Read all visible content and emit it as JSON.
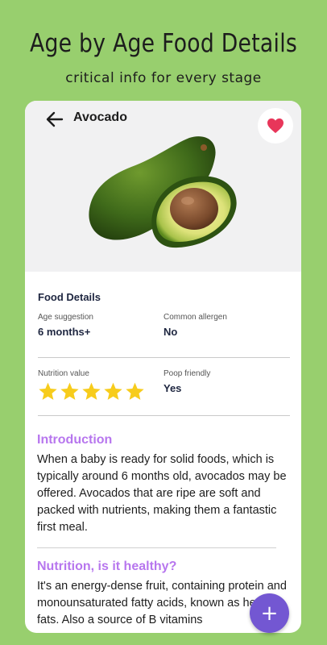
{
  "promo": {
    "headline": "Age by Age Food Details",
    "subheadline": "critical info for every stage"
  },
  "header": {
    "title": "Avocado",
    "back_icon": "arrow-left-icon",
    "favorite_icon": "heart-icon"
  },
  "details": {
    "section_title": "Food Details",
    "age_label": "Age suggestion",
    "age_value": "6 months+",
    "allergen_label": "Common allergen",
    "allergen_value": "No",
    "nutrition_label": "Nutrition value",
    "nutrition_rating": 5,
    "nutrition_max": 5,
    "poop_label": "Poop friendly",
    "poop_value": "Yes"
  },
  "article": {
    "intro_heading": "Introduction",
    "intro_body": "When a baby is ready for solid foods, which is typically around 6 months old, avocados may be offered. Avocados that are ripe are soft and packed with nutrients, making them a fantastic first meal.",
    "nutrition_heading": "Nutrition, is it healthy?",
    "nutrition_body": "It's an energy-dense fruit, containing protein and monounsaturated fatty acids, known as healthy fats. Also a source of B vitamins"
  },
  "fab": {
    "label": "+"
  },
  "colors": {
    "background": "#98cf6e",
    "accent_purple": "#b776ee",
    "fab": "#7357d2",
    "heart": "#e8365a",
    "star": "#f7cc1c"
  }
}
